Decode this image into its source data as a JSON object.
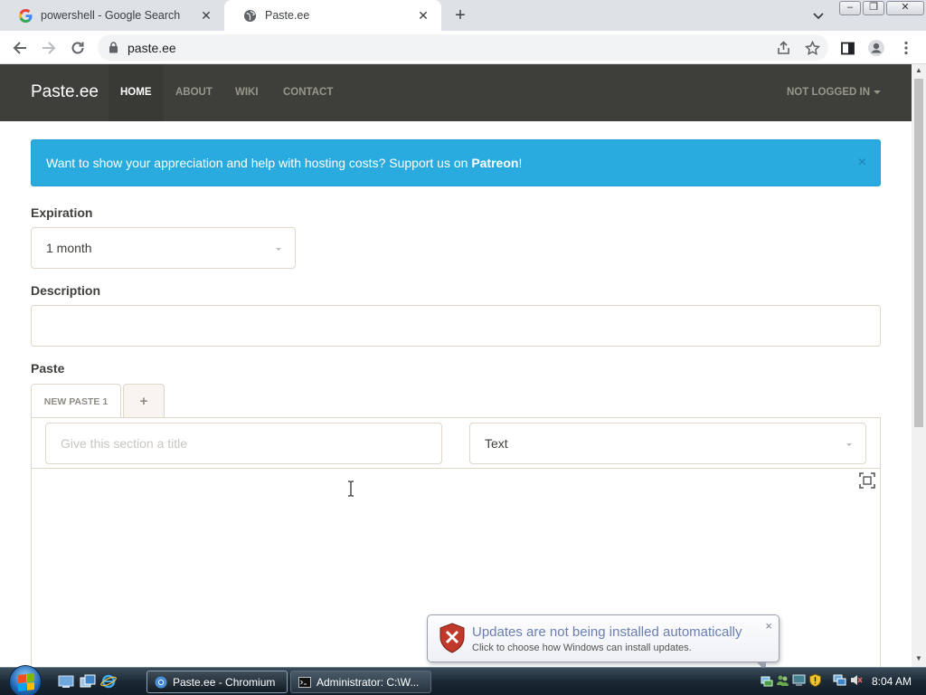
{
  "browser": {
    "tabs": [
      {
        "title": "powershell - Google Search",
        "close": "✕",
        "active": false
      },
      {
        "title": "Paste.ee",
        "close": "✕",
        "active": true
      }
    ],
    "new_tab": "+",
    "window_buttons": {
      "minimize": "–",
      "restore": "❐",
      "close": "✕"
    },
    "url": "paste.ee"
  },
  "site": {
    "brand": "Paste.ee",
    "nav": [
      {
        "label": "HOME",
        "active": true
      },
      {
        "label": "ABOUT",
        "active": false
      },
      {
        "label": "WIKI",
        "active": false
      },
      {
        "label": "CONTACT",
        "active": false
      }
    ],
    "account": "NOT LOGGED IN"
  },
  "alert": {
    "text": "Want to show your appreciation and help with hosting costs? Support us on ",
    "link": "Patreon",
    "suffix": "!",
    "close": "×"
  },
  "form": {
    "expiration_label": "Expiration",
    "expiration_value": "1 month",
    "description_label": "Description",
    "description_value": "",
    "paste_label": "Paste",
    "paste_tabs": [
      "NEW PASTE 1"
    ],
    "add_tab": "+",
    "section_title_placeholder": "Give this section a title",
    "syntax_value": "Text"
  },
  "notification": {
    "title": "Updates are not being installed automatically",
    "body": "Click to choose how Windows can install updates.",
    "close": "×"
  },
  "taskbar": {
    "tasks": [
      {
        "label": "Paste.ee - Chromium",
        "active": true
      },
      {
        "label": "Administrator: C:\\W...",
        "active": false
      }
    ],
    "clock": "8:04 AM"
  },
  "colors": {
    "navbar": "#3e3f3a",
    "alert": "#29abe0",
    "text": "#3e3f3a",
    "border": "#dfd7ca"
  }
}
